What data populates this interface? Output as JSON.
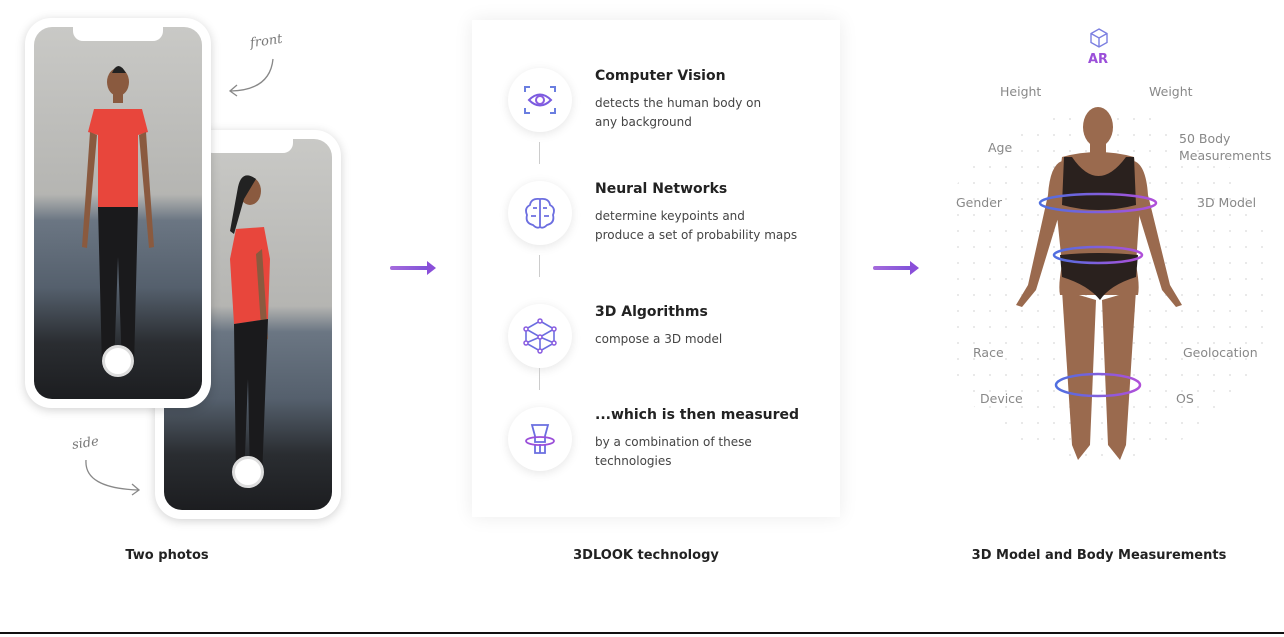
{
  "left": {
    "front_label": "front",
    "side_label": "side",
    "caption": "Two photos"
  },
  "center": {
    "caption": "3DLOOK technology",
    "steps": [
      {
        "icon": "eye-scan-icon",
        "title": "Computer Vision",
        "desc": [
          "detects the human body on",
          "any background"
        ]
      },
      {
        "icon": "brain-icon",
        "title": "Neural Networks",
        "desc": [
          "determine keypoints and",
          "produce a set of probability maps"
        ]
      },
      {
        "icon": "3d-cube-icon",
        "title": "3D Algorithms",
        "desc": [
          "compose a 3D model"
        ]
      },
      {
        "icon": "body-measure-icon",
        "title": "...which is then measured",
        "desc": [
          "by a combination of these",
          "technologies"
        ]
      }
    ]
  },
  "right": {
    "ar_label": "AR",
    "caption": "3D Model and Body Measurements",
    "labels": {
      "height": "Height",
      "weight": "Weight",
      "age": "Age",
      "body_measurements": [
        "50 Body",
        "Measurements"
      ],
      "gender": "Gender",
      "model": "3D Model",
      "race": "Race",
      "geolocation": "Geolocation",
      "device": "Device",
      "os": "OS"
    }
  },
  "colors": {
    "accent_purple": "#9b4fd9",
    "accent_blue": "#4f6fe0",
    "shirt_red": "#e8463c"
  }
}
